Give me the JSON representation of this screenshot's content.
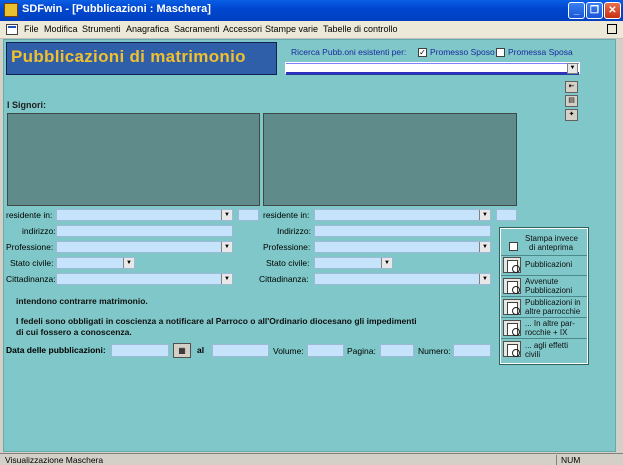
{
  "window": {
    "title": "SDFwin - [Pubblicazioni : Maschera]"
  },
  "menu": [
    "File",
    "Modifica",
    "Strumenti",
    "Anagrafica",
    "Sacramenti",
    "Accessori",
    "Stampe varie",
    "Tabelle di controllo"
  ],
  "header": {
    "title": "Pubblicazioni di matrimonio"
  },
  "search": {
    "label": "Ricerca Pubb.oni esistenti per:",
    "opt1": {
      "label": "Promesso Sposo",
      "checked": true
    },
    "opt2": {
      "label": "Promessa Sposa",
      "checked": false
    },
    "value": ""
  },
  "signori_label": "I Signori:",
  "left": {
    "residente_label": "residente in:",
    "indirizzo_label": "indirizzo:",
    "professione_label": "Professione:",
    "stato_label": "Stato civile:",
    "cittadinanza_label": "Cittadinanza:"
  },
  "right": {
    "residente_label": "residente in:",
    "indirizzo_label": "Indirizzo:",
    "professione_label": "Professione:",
    "stato_label": "Stato civile:",
    "cittadinanza_label": "Cittadinanza:"
  },
  "text1": "intendono contrarre matrimonio.",
  "text2a": "I fedeli sono obbligati in coscienza a notificare al Parroco o all'Ordinario diocesano gli impedimenti",
  "text2b": "di cui fossero a conoscenza.",
  "bottom": {
    "date_label": "Data delle pubblicazioni:",
    "al_label": "al",
    "volume_label": "Volume:",
    "pagina_label": "Pagina:",
    "numero_label": "Numero:"
  },
  "side": {
    "preview_label_1": "Stampa invece",
    "preview_label_2": "di anteprima",
    "btn1": "Pubblicazioni",
    "btn2a": "Avvenute",
    "btn2b": "Pubblicazioni",
    "btn3a": "Pubblicazioni in",
    "btn3b": "altre parrocchie",
    "btn4a": "... In altre par-",
    "btn4b": "rocchie + IX",
    "btn5a": "... agli effetti",
    "btn5b": "civili"
  },
  "status": {
    "text": "Visualizzazione Maschera",
    "num": "NUM"
  },
  "icons": {
    "app": "app-icon",
    "min": "minimize-icon",
    "max": "maximize-icon",
    "close": "close-icon",
    "calendar": "calendar-icon",
    "print": "print-preview-icon"
  }
}
